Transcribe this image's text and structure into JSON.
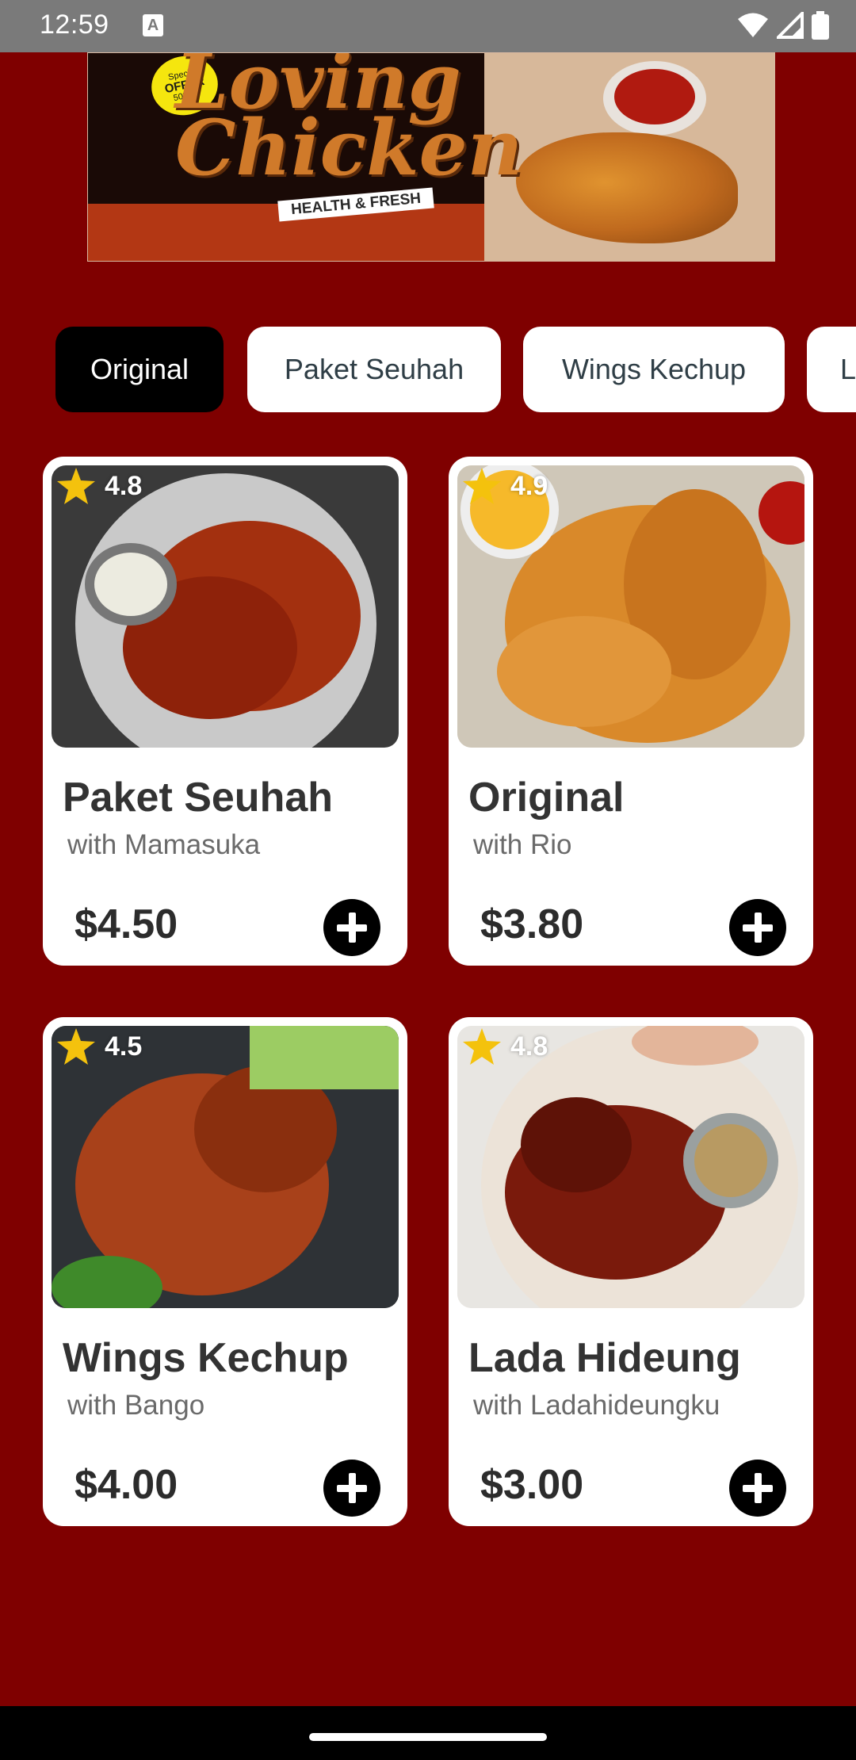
{
  "status_bar": {
    "time": "12:59",
    "notification_icon": "a-box-icon",
    "icons": [
      "wifi-icon",
      "signal-icon",
      "battery-icon"
    ]
  },
  "banner": {
    "badge_line1": "Special",
    "badge_line2": "OFFER",
    "badge_line3": "50%off",
    "title_line1": "Loving",
    "title_line2": "Chicken",
    "subtitle": "HEALTH & FRESH"
  },
  "categories": [
    {
      "label": "Original",
      "selected": true
    },
    {
      "label": "Paket Seuhah",
      "selected": false
    },
    {
      "label": "Wings Kechup",
      "selected": false
    },
    {
      "label": "L",
      "selected": false
    }
  ],
  "products": [
    {
      "name": "Paket Seuhah",
      "subtitle": "with Mamasuka",
      "price": "$4.50",
      "rating": "4.8"
    },
    {
      "name": "Original",
      "subtitle": "with Rio",
      "price": "$3.80",
      "rating": "4.9"
    },
    {
      "name": "Wings Kechup",
      "subtitle": "with Bango",
      "price": "$4.00",
      "rating": "4.5"
    },
    {
      "name": "Lada Hideung",
      "subtitle": "with Ladahideungku",
      "price": "$3.00",
      "rating": "4.8"
    }
  ],
  "colors": {
    "background": "#7f0000",
    "card": "#ffffff",
    "tab_active": "#000000",
    "star": "#f4c20d"
  }
}
